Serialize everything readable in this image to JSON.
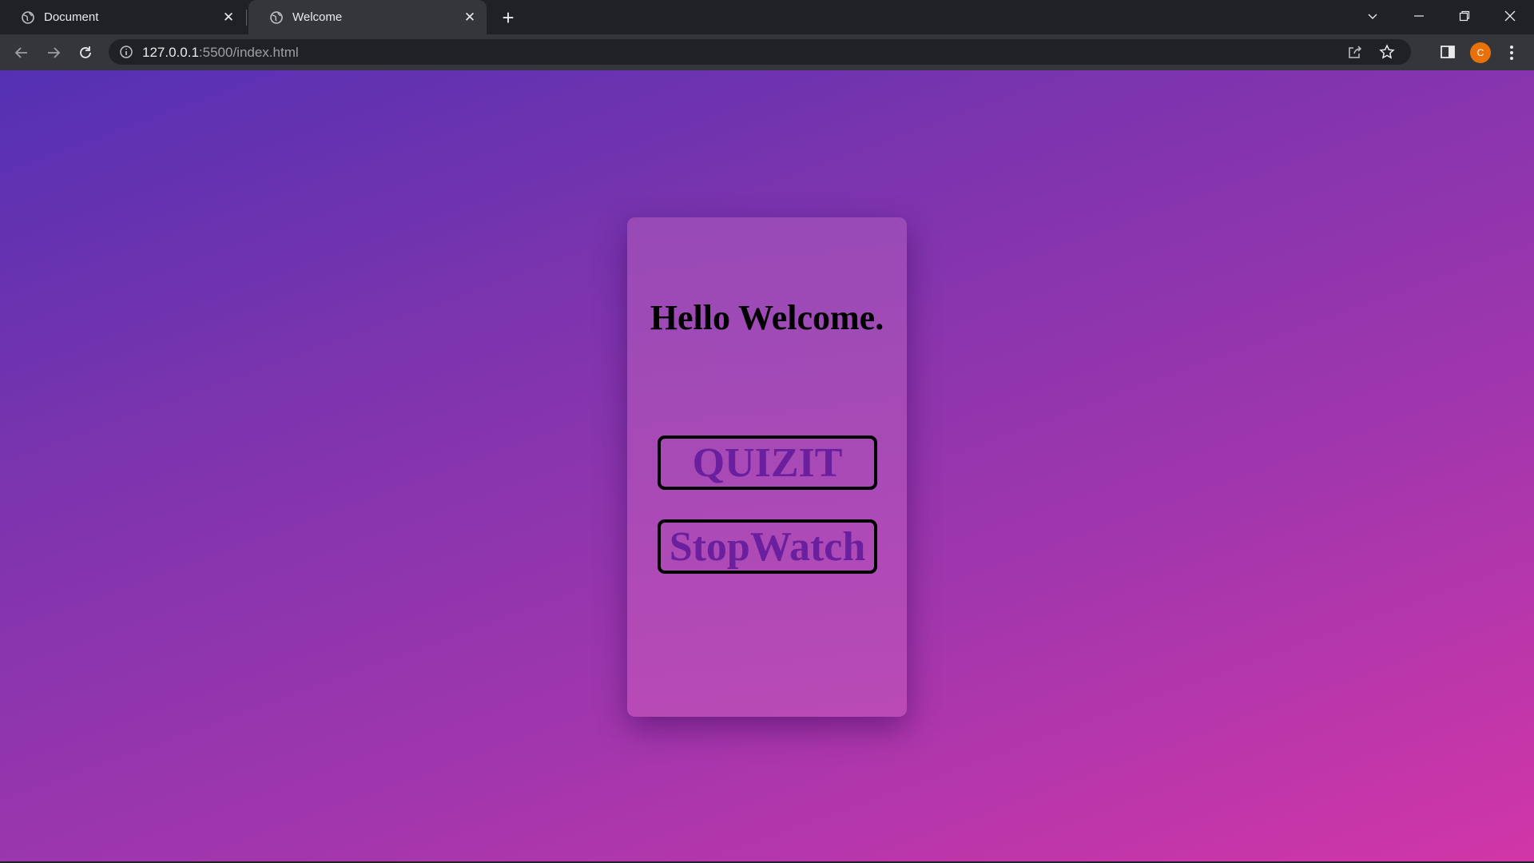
{
  "browser": {
    "tabs": [
      {
        "title": "Document",
        "active": false
      },
      {
        "title": "Welcome",
        "active": true
      }
    ],
    "url_host": "127.0.0.1",
    "url_path": ":5500/index.html",
    "profile_initial": "C"
  },
  "page": {
    "heading": "Hello Welcome.",
    "buttons": {
      "quiz": "QUIZIT",
      "stopwatch": "StopWatch"
    }
  },
  "colors": {
    "gradient_start": "#5431b3",
    "gradient_end": "#d136a8",
    "button_text": "#6a1f9e",
    "avatar": "#e8710a"
  }
}
